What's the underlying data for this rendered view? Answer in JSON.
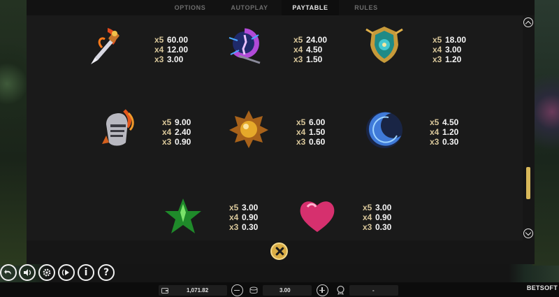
{
  "tabs": [
    {
      "label": "OPTIONS",
      "active": false
    },
    {
      "label": "AUTOPLAY",
      "active": false
    },
    {
      "label": "PAYTABLE",
      "active": true
    },
    {
      "label": "RULES",
      "active": false
    }
  ],
  "paytable": [
    {
      "symbol": "flaming-dagger-icon",
      "pays": [
        {
          "mult": "x5",
          "amount": "60.00"
        },
        {
          "mult": "x4",
          "amount": "12.00"
        },
        {
          "mult": "x3",
          "amount": "3.00"
        }
      ]
    },
    {
      "symbol": "purple-amulet-icon",
      "pays": [
        {
          "mult": "x5",
          "amount": "24.00"
        },
        {
          "mult": "x4",
          "amount": "4.50"
        },
        {
          "mult": "x3",
          "amount": "1.50"
        }
      ]
    },
    {
      "symbol": "shield-crest-icon",
      "pays": [
        {
          "mult": "x5",
          "amount": "18.00"
        },
        {
          "mult": "x4",
          "amount": "3.00"
        },
        {
          "mult": "x3",
          "amount": "1.20"
        }
      ]
    },
    {
      "symbol": "knight-helmet-icon",
      "pays": [
        {
          "mult": "x5",
          "amount": "9.00"
        },
        {
          "mult": "x4",
          "amount": "2.40"
        },
        {
          "mult": "x3",
          "amount": "0.90"
        }
      ]
    },
    {
      "symbol": "gold-sun-gem-icon",
      "pays": [
        {
          "mult": "x5",
          "amount": "6.00"
        },
        {
          "mult": "x4",
          "amount": "1.50"
        },
        {
          "mult": "x3",
          "amount": "0.60"
        }
      ]
    },
    {
      "symbol": "blue-moon-gem-icon",
      "pays": [
        {
          "mult": "x5",
          "amount": "4.50"
        },
        {
          "mult": "x4",
          "amount": "1.20"
        },
        {
          "mult": "x3",
          "amount": "0.30"
        }
      ]
    },
    {
      "symbol": "green-star-gem-icon",
      "pays": [
        {
          "mult": "x5",
          "amount": "3.00"
        },
        {
          "mult": "x4",
          "amount": "0.90"
        },
        {
          "mult": "x3",
          "amount": "0.30"
        }
      ]
    },
    {
      "symbol": "pink-heart-gem-icon",
      "pays": [
        {
          "mult": "x5",
          "amount": "3.00"
        },
        {
          "mult": "x4",
          "amount": "0.90"
        },
        {
          "mult": "x3",
          "amount": "0.30"
        }
      ]
    }
  ],
  "scroll": {
    "position_fraction": 0.84
  },
  "controls": [
    {
      "name": "back-icon"
    },
    {
      "name": "sound-icon"
    },
    {
      "name": "settings-icon"
    },
    {
      "name": "autoplay-icon"
    },
    {
      "name": "info-icon",
      "label": "i"
    },
    {
      "name": "help-icon",
      "label": "?"
    }
  ],
  "bottom_bar": {
    "balance": "1,071.82",
    "bet": "3.00",
    "win": "-",
    "brand": "BETSOFT"
  },
  "colors": {
    "accent_gold": "#d9ad45",
    "multiplier": "#d9c79a",
    "panel_bg": "#1a1a1a"
  }
}
